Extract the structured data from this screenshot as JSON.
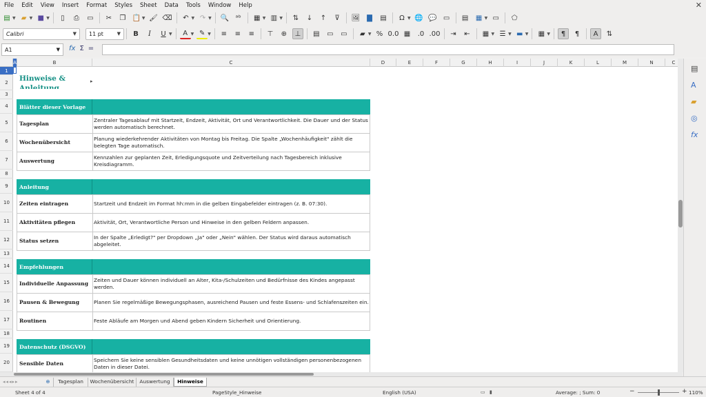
{
  "menu": [
    "File",
    "Edit",
    "View",
    "Insert",
    "Format",
    "Styles",
    "Sheet",
    "Data",
    "Tools",
    "Window",
    "Help"
  ],
  "font": {
    "name": "Calibri",
    "size": "11 pt"
  },
  "formula": {
    "cell_ref": "A1",
    "fx": "fx",
    "sum": "Σ",
    "eq": "="
  },
  "columns": [
    "A",
    "B",
    "C",
    "D",
    "E",
    "F",
    "G",
    "H",
    "I",
    "J",
    "K",
    "L",
    "M",
    "N",
    "C"
  ],
  "rows": [
    "1",
    "2",
    "3",
    "4",
    "5",
    "6",
    "7",
    "8",
    "9",
    "10",
    "11",
    "12",
    "13",
    "14",
    "15",
    "16",
    "17",
    "18",
    "19",
    "20"
  ],
  "sheet": {
    "title": "Hinweise & Anleitung",
    "sections": [
      {
        "heading": "Blätter dieser Vorlage",
        "items": [
          {
            "label": "Tagesplan",
            "text": "Zentraler Tagesablauf mit Startzeit, Endzeit, Aktivität, Ort und Verantwortlichkeit. Die Dauer und der Status werden automatisch berechnet."
          },
          {
            "label": "Wochenübersicht",
            "text": "Planung wiederkehrender Aktivitäten von Montag bis Freitag. Die Spalte „Wochenhäufigkeit\" zählt die belegten Tage automatisch."
          },
          {
            "label": "Auswertung",
            "text": "Kennzahlen zur geplanten Zeit, Erledigungsquote und Zeitverteilung nach Tagesbereich inklusive Kreisdiagramm."
          }
        ]
      },
      {
        "heading": "Anleitung",
        "items": [
          {
            "label": "Zeiten eintragen",
            "text": "Startzeit und Endzeit im Format hh:mm in die gelben Eingabefelder eintragen (z. B. 07:30)."
          },
          {
            "label": "Aktivitäten pflegen",
            "text": "Aktivität, Ort, Verantwortliche Person und Hinweise in den gelben Feldern anpassen."
          },
          {
            "label": "Status setzen",
            "text": "In der Spalte „Erledigt?\" per Dropdown „Ja\" oder „Nein\" wählen. Der Status wird daraus automatisch abgeleitet."
          }
        ]
      },
      {
        "heading": "Empfehlungen",
        "items": [
          {
            "label": "Individuelle Anpassung",
            "text": "Zeiten und Dauer können individuell an Alter, Kita-/Schulzeiten und Bedürfnisse des Kindes angepasst werden."
          },
          {
            "label": "Pausen & Bewegung",
            "text": "Planen Sie regelmäßige Bewegungsphasen, ausreichend Pausen und feste Essens- und Schlafenszeiten ein."
          },
          {
            "label": "Routinen",
            "text": "Feste Abläufe am Morgen und Abend geben Kindern Sicherheit und Orientierung."
          }
        ]
      },
      {
        "heading": "Datenschutz (DSGVO)",
        "items": [
          {
            "label": "Sensible Daten",
            "text": "Speichern Sie keine sensiblen Gesundheitsdaten und keine unnötigen vollständigen personenbezogenen Daten in dieser Datei."
          }
        ]
      }
    ]
  },
  "tabs": [
    "Tagesplan",
    "Wochenübersicht",
    "Auswertung",
    "Hinweise"
  ],
  "active_tab": "Hinweise",
  "status": {
    "sheet": "Sheet 4 of 4",
    "page_style": "PageStyle_Hinweise",
    "language": "English (USA)",
    "summary": "Average: ; Sum: 0",
    "zoom": "110%"
  },
  "colors": {
    "accent": "#17b1a3",
    "title": "#138f84",
    "selection": "#3a6fc4"
  }
}
